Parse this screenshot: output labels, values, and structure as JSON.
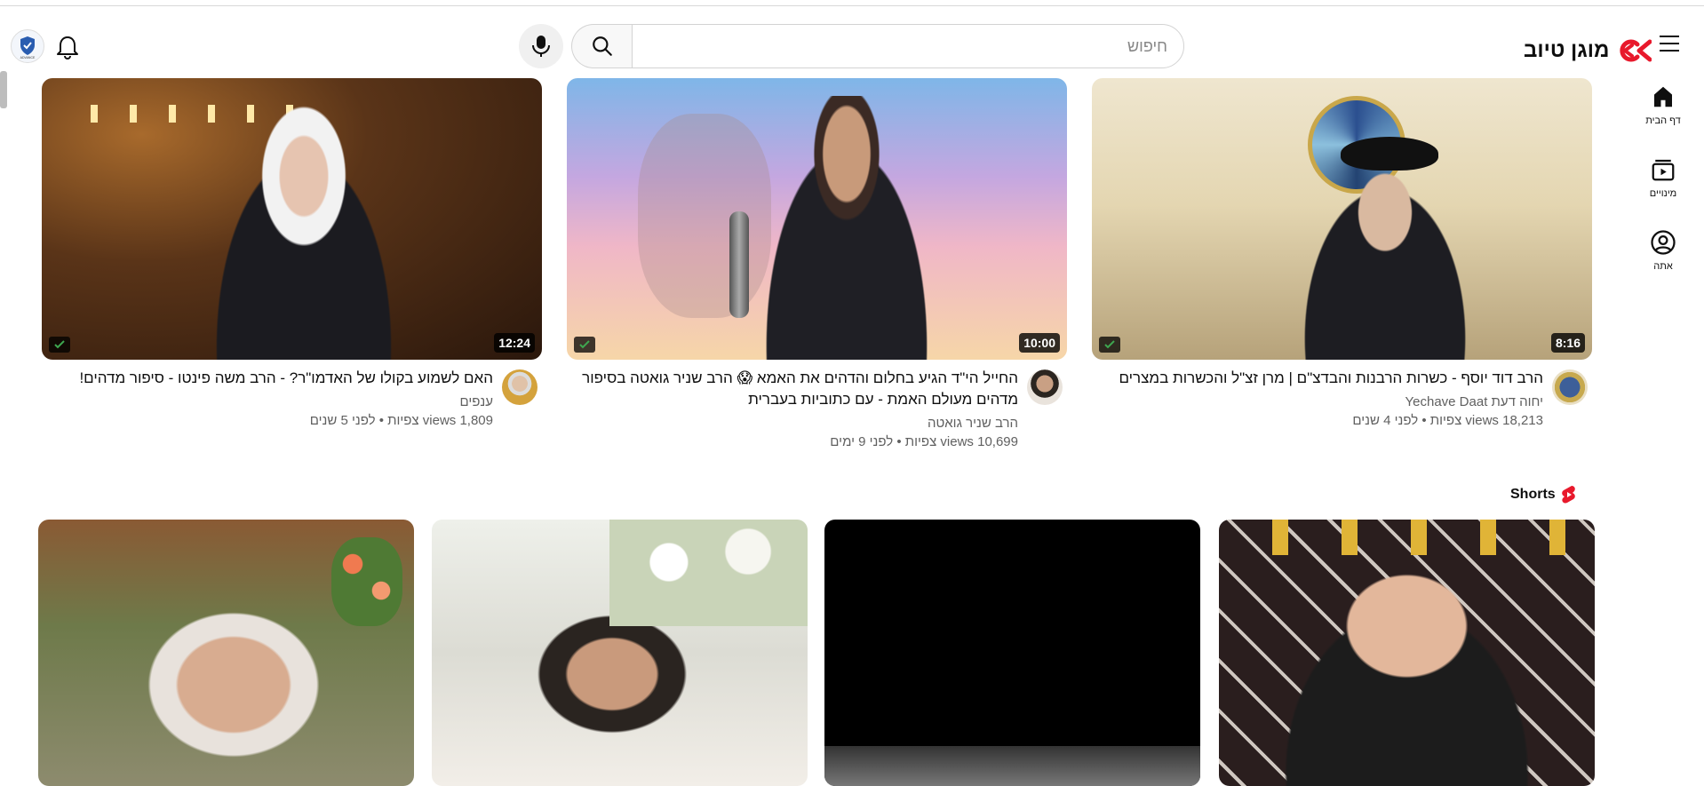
{
  "header": {
    "logo_text": "מוגן טיוב",
    "search_placeholder": "חיפוש",
    "account_badge": "ADVANCE"
  },
  "sidebar": {
    "items": [
      {
        "label": "דף הבית",
        "icon": "home-icon"
      },
      {
        "label": "מינויים",
        "icon": "subscriptions-icon"
      },
      {
        "label": "אתה",
        "icon": "account-icon"
      }
    ]
  },
  "videos": [
    {
      "title": "הרב דוד יוסף - כשרות הרבנות והבדצ\"ם | מרן זצ\"ל והכשרות במצרים",
      "channel": "יחוה דעת Yechave Daat",
      "stats": "18,213 views צפיות • לפני 4 שנים",
      "duration": "8:16"
    },
    {
      "title": "החייל הי\"ד הגיע בחלום והדהים את האמא 😱 הרב שניר גואטה בסיפור מדהים מעולם האמת - עם כתוביות בעברית",
      "channel": "הרב שניר גואטה",
      "stats": "10,699 views צפיות • לפני 9 ימים",
      "duration": "10:00"
    },
    {
      "title": "האם לשמוע בקולו של האדמו\"ר? - הרב משה פינטו - סיפור מדהים!",
      "channel": "ענפים",
      "stats": "1,809 views צפיות • לפני 5 שנים",
      "duration": "12:24"
    }
  ],
  "shorts": {
    "heading": "Shorts",
    "count": 4
  },
  "colors": {
    "brand_red": "#e8192c",
    "text_primary": "#0f0f0f",
    "text_secondary": "#606060"
  }
}
